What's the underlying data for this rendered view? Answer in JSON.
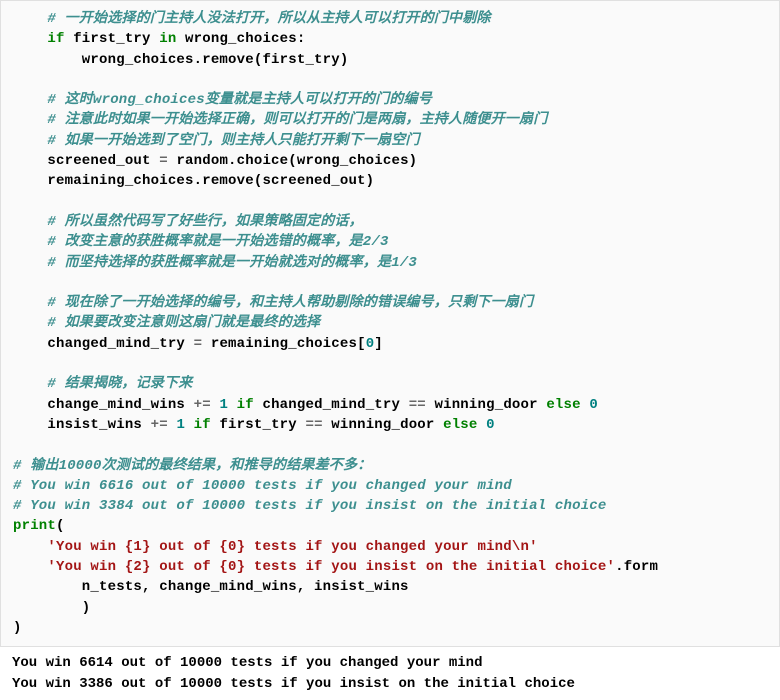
{
  "code": {
    "l1": "    # 一开始选择的门主持人没法打开，所以从主持人可以打开的门中剔除",
    "l2a": "    ",
    "l2_if": "if",
    "l2b": " first_try ",
    "l2_in": "in",
    "l2c": " wrong_choices:",
    "l3": "        wrong_choices.remove(first_try)",
    "l4": "",
    "l5": "    # 这时wrong_choices变量就是主持人可以打开的门的编号",
    "l6": "    # 注意此时如果一开始选择正确，则可以打开的门是两扇，主持人随便开一扇门",
    "l7": "    # 如果一开始选到了空门，则主持人只能打开剩下一扇空门",
    "l8a": "    screened_out ",
    "l8_eq": "=",
    "l8b": " random.choice(wrong_choices)",
    "l9": "    remaining_choices.remove(screened_out)",
    "l10": "",
    "l11": "    # 所以虽然代码写了好些行，如果策略固定的话，",
    "l12": "    # 改变主意的获胜概率就是一开始选错的概率，是2/3",
    "l13": "    # 而坚持选择的获胜概率就是一开始就选对的概率，是1/3",
    "l14": "",
    "l15": "    # 现在除了一开始选择的编号，和主持人帮助剔除的错误编号，只剩下一扇门",
    "l16": "    # 如果要改变注意则这扇门就是最终的选择",
    "l17a": "    changed_mind_try ",
    "l17_eq": "=",
    "l17b": " remaining_choices[",
    "l17_zero": "0",
    "l17c": "]",
    "l18": "",
    "l19": "    # 结果揭晓，记录下来",
    "l20a": "    change_mind_wins ",
    "l20_op": "+=",
    "l20b": " ",
    "l20_one": "1",
    "l20c": " ",
    "l20_if": "if",
    "l20d": " changed_mind_try ",
    "l20_eq": "==",
    "l20e": " winning_door ",
    "l20_else": "else",
    "l20f": " ",
    "l20_zero": "0",
    "l21a": "    insist_wins ",
    "l21_op": "+=",
    "l21b": " ",
    "l21_one": "1",
    "l21c": " ",
    "l21_if": "if",
    "l21d": " first_try ",
    "l21_eq": "==",
    "l21e": " winning_door ",
    "l21_else": "else",
    "l21f": " ",
    "l21_zero": "0",
    "l22": "",
    "l23": "# 输出10000次测试的最终结果，和推导的结果差不多：",
    "l24": "# You win 6616 out of 10000 tests if you changed your mind",
    "l25": "# You win 3384 out of 10000 tests if you insist on the initial choice",
    "l26_print": "print",
    "l26b": "(",
    "l27": "    'You win {1} out of {0} tests if you changed your mind\\n'",
    "l28a": "    'You win {2} out of {0} tests if you insist on the initial choice'",
    "l28b": ".form",
    "l29": "        n_tests, change_mind_wins, insist_wins",
    "l30": "        )",
    "l31": ")"
  },
  "output": {
    "line1": "You win 6614 out of 10000 tests if you changed your mind",
    "line2": "You win 3386 out of 10000 tests if you insist on the initial choice"
  }
}
